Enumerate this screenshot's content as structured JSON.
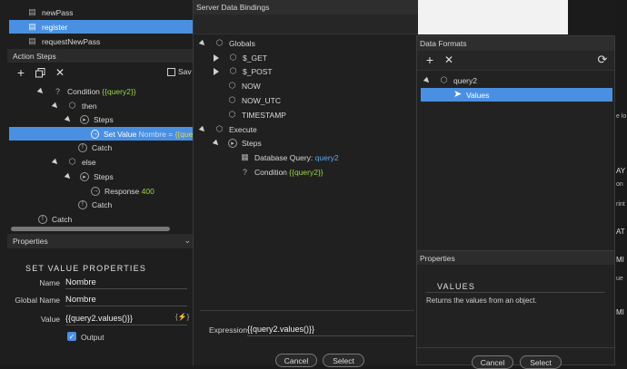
{
  "left": {
    "files": [
      {
        "label": "newPass",
        "selected": false
      },
      {
        "label": "register",
        "selected": true
      },
      {
        "label": "requestNewPass",
        "selected": false
      }
    ],
    "action_steps_title": "Action Steps",
    "save_label": "Sav",
    "tree": {
      "condition_label": "Condition",
      "condition_expr": "{{query2}}",
      "then_label": "then",
      "steps_label": "Steps",
      "set_value_label": "Set Value",
      "set_value_name": "Nombre",
      "set_value_eq": "=",
      "set_value_expr": "{{quer",
      "catch_label": "Catch",
      "else_label": "else",
      "steps2_label": "Steps",
      "response_label": "Response",
      "response_value": "400",
      "catch2_label": "Catch",
      "catch3_label": "Catch"
    },
    "properties_title": "Properties",
    "set_value_props_title": "SET VALUE PROPERTIES",
    "fields": {
      "name_label": "Name",
      "name_value": "Nombre",
      "global_name_label": "Global Name",
      "global_name_value": "Nombre",
      "value_label": "Value",
      "value_value": "{{query2.values()}}",
      "output_label": "Output"
    }
  },
  "bindings": {
    "title": "Server Data Bindings",
    "tree": {
      "globals": "Globals",
      "get": "$_GET",
      "post": "$_POST",
      "now": "NOW",
      "now_utc": "NOW_UTC",
      "timestamp": "TIMESTAMP",
      "execute": "Execute",
      "steps": "Steps",
      "db_query_label": "Database Query:",
      "db_query_value": "query2",
      "condition_label": "Condition",
      "condition_value": "{{query2}}"
    },
    "expression_label": "Expression",
    "expression_value": "{{query2.values()}}",
    "cancel": "Cancel",
    "select": "Select"
  },
  "formats": {
    "title": "Data Formats",
    "tree": {
      "query2": "query2",
      "values": "Values"
    },
    "properties_title": "Properties",
    "values_heading": "VALUES",
    "values_desc": "Returns the values from an object.",
    "cancel": "Cancel",
    "select": "Select"
  },
  "right_edge": {
    "labels": [
      "e lo",
      "AY",
      "on",
      "rint",
      "AT",
      "MI",
      "ue",
      "MI"
    ]
  },
  "colors": {
    "selection": "#4a90e2",
    "accent_green": "#9bd149",
    "accent_blue": "#5fa9ea"
  }
}
